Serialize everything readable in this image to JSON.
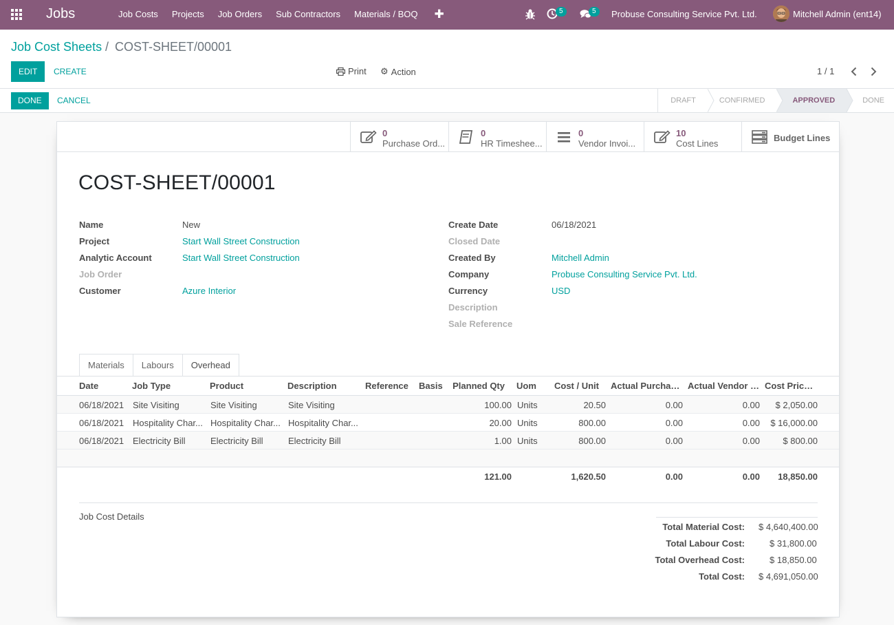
{
  "navbar": {
    "app_title": "Jobs",
    "menu": [
      "Job Costs",
      "Projects",
      "Job Orders",
      "Sub Contractors",
      "Materials / BOQ"
    ],
    "activity_count": "5",
    "message_count": "5",
    "company": "Probuse Consulting Service Pvt. Ltd.",
    "user": "Mitchell Admin (ent14)",
    "accent": "#875a7b"
  },
  "breadcrumb": {
    "parent": "Job Cost Sheets",
    "separator": "/",
    "current": "COST-SHEET/00001"
  },
  "toolbar": {
    "edit": "EDIT",
    "create": "CREATE",
    "print": "Print",
    "action": "Action",
    "pager": "1 / 1"
  },
  "statusbar": {
    "done": "DONE",
    "cancel": "CANCEL",
    "stages": [
      "DRAFT",
      "CONFIRMED",
      "APPROVED",
      "DONE"
    ],
    "active_stage": "APPROVED"
  },
  "smart_buttons": [
    {
      "value": "0",
      "label": "Purchase Ord...",
      "icon": "edit-icon"
    },
    {
      "value": "0",
      "label": "HR Timeshee...",
      "icon": "book-icon"
    },
    {
      "value": "0",
      "label": "Vendor Invoi...",
      "icon": "list-icon"
    },
    {
      "value": "10",
      "label": "Cost Lines",
      "icon": "edit-icon"
    },
    {
      "value": "",
      "label": "Budget Lines",
      "icon": "server-icon"
    }
  ],
  "record": {
    "title": "COST-SHEET/00001",
    "left_fields": [
      {
        "label": "Name",
        "value": "New",
        "link": false,
        "muted": false
      },
      {
        "label": "Project",
        "value": "Start Wall Street Construction",
        "link": true,
        "muted": false
      },
      {
        "label": "Analytic Account",
        "value": "Start Wall Street Construction",
        "link": true,
        "muted": false
      },
      {
        "label": "Job Order",
        "value": "",
        "link": false,
        "muted": true
      },
      {
        "label": "Customer",
        "value": "Azure Interior",
        "link": true,
        "muted": false
      }
    ],
    "right_fields": [
      {
        "label": "Create Date",
        "value": "06/18/2021",
        "link": false,
        "muted": false
      },
      {
        "label": "Closed Date",
        "value": "",
        "link": false,
        "muted": true
      },
      {
        "label": "Created By",
        "value": "Mitchell Admin",
        "link": true,
        "muted": false
      },
      {
        "label": "Company",
        "value": "Probuse Consulting Service Pvt. Ltd.",
        "link": true,
        "muted": false
      },
      {
        "label": "Currency",
        "value": "USD",
        "link": true,
        "muted": false
      },
      {
        "label": "Description",
        "value": "",
        "link": false,
        "muted": true
      },
      {
        "label": "Sale Reference",
        "value": "",
        "link": false,
        "muted": true
      }
    ]
  },
  "tabs": {
    "items": [
      "Materials",
      "Labours",
      "Overhead"
    ],
    "active": "Overhead"
  },
  "table": {
    "columns": [
      "Date",
      "Job Type",
      "Product",
      "Description",
      "Reference",
      "Basis",
      "Planned Qty",
      "Uom",
      "Cost / Unit",
      "Actual Purchas...",
      "Actual Vendor B...",
      "Cost Price ..."
    ],
    "rows": [
      [
        "06/18/2021",
        "Site Visiting",
        "Site Visiting",
        "Site Visiting",
        "",
        "",
        "100.00",
        "Units",
        "20.50",
        "0.00",
        "0.00",
        "$ 2,050.00"
      ],
      [
        "06/18/2021",
        "Hospitality Char...",
        "Hospitality Char...",
        "Hospitality Char...",
        "",
        "",
        "20.00",
        "Units",
        "800.00",
        "0.00",
        "0.00",
        "$ 16,000.00"
      ],
      [
        "06/18/2021",
        "Electricity Bill",
        "Electricity Bill",
        "Electricity Bill",
        "",
        "",
        "1.00",
        "Units",
        "800.00",
        "0.00",
        "0.00",
        "$ 800.00"
      ]
    ],
    "totals": {
      "planned_qty": "121.00",
      "cost_unit": "1,620.50",
      "actual_purchase": "0.00",
      "actual_vendor": "0.00",
      "cost_price": "18,850.00"
    }
  },
  "summary": {
    "details_label": "Job Cost Details",
    "items": [
      {
        "label": "Total Material Cost:",
        "value": "$ 4,640,400.00"
      },
      {
        "label": "Total Labour Cost:",
        "value": "$ 31,800.00"
      },
      {
        "label": "Total Overhead Cost:",
        "value": "$ 18,850.00"
      },
      {
        "label": "Total Cost:",
        "value": "$ 4,691,050.00"
      }
    ]
  }
}
